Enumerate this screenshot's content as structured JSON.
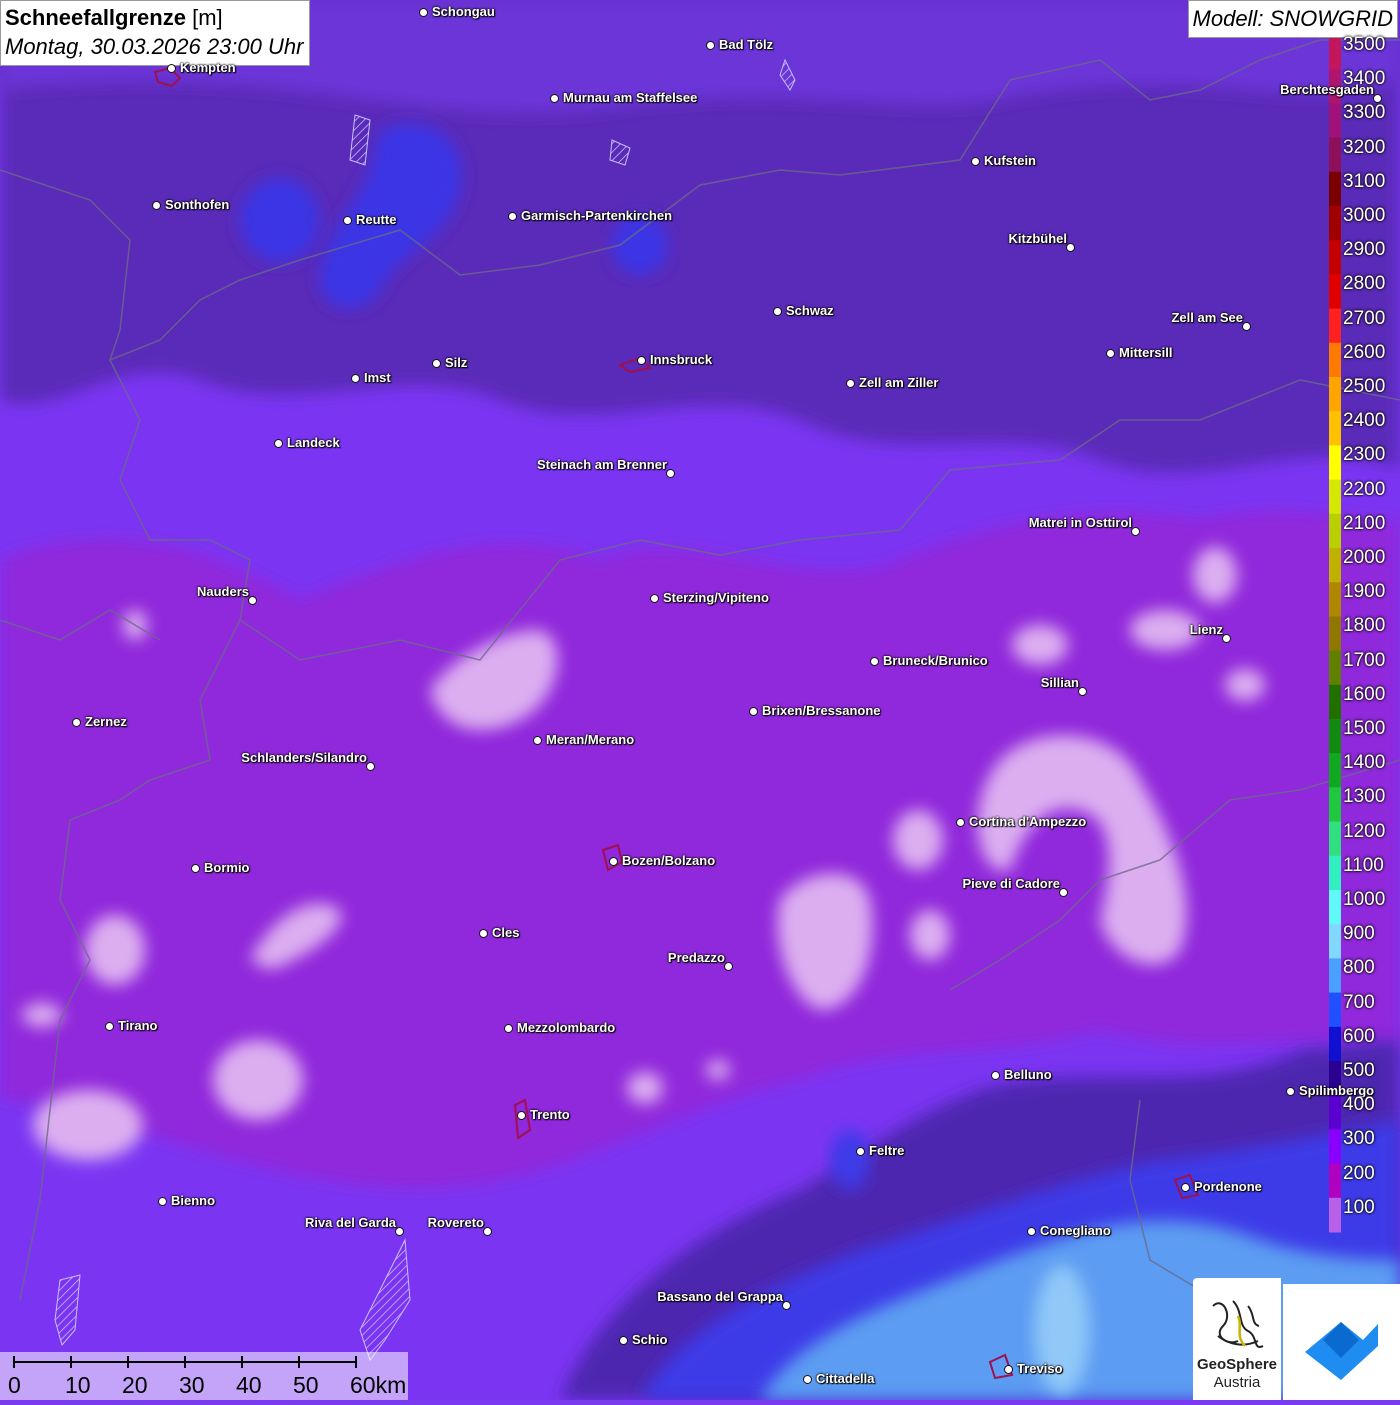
{
  "header": {
    "title_bold": "Schneefallgrenze",
    "title_unit": "[m]",
    "datetime": "Montag, 30.03.2026 23:00 Uhr",
    "model": "Modell: SNOWGRID"
  },
  "places": [
    {
      "name": "Schongau"
    },
    {
      "name": "Bad Tölz"
    },
    {
      "name": "Kempten"
    },
    {
      "name": "Murnau am Staffelsee"
    },
    {
      "name": "Berchtesgaden"
    },
    {
      "name": "Kufstein"
    },
    {
      "name": "Sonthofen"
    },
    {
      "name": "Reutte"
    },
    {
      "name": "Garmisch-Partenkirchen"
    },
    {
      "name": "Kitzbühel"
    },
    {
      "name": "Schwaz"
    },
    {
      "name": "Zell am See"
    },
    {
      "name": "Innsbruck"
    },
    {
      "name": "Mittersill"
    },
    {
      "name": "Imst"
    },
    {
      "name": "Silz"
    },
    {
      "name": "Zell am Ziller"
    },
    {
      "name": "Landeck"
    },
    {
      "name": "Steinach am Brenner"
    },
    {
      "name": "Matrei in Osttirol"
    },
    {
      "name": "Nauders"
    },
    {
      "name": "Sterzing/Vipiteno"
    },
    {
      "name": "Lienz"
    },
    {
      "name": "Bruneck/Brunico"
    },
    {
      "name": "Sillian"
    },
    {
      "name": "Zernez"
    },
    {
      "name": "Brixen/Bressanone"
    },
    {
      "name": "Meran/Merano"
    },
    {
      "name": "Schlanders/Silandro"
    },
    {
      "name": "Cortina d'Ampezzo"
    },
    {
      "name": "Bozen/Bolzano"
    },
    {
      "name": "Bormio"
    },
    {
      "name": "Pieve di Cadore"
    },
    {
      "name": "Cles"
    },
    {
      "name": "Predazzo"
    },
    {
      "name": "Tirano"
    },
    {
      "name": "Mezzolombardo"
    },
    {
      "name": "Belluno"
    },
    {
      "name": "Spilimbergo"
    },
    {
      "name": "Trento"
    },
    {
      "name": "Feltre"
    },
    {
      "name": "Pordenone"
    },
    {
      "name": "Bienno"
    },
    {
      "name": "Riva del Garda"
    },
    {
      "name": "Rovereto"
    },
    {
      "name": "Conegliano"
    },
    {
      "name": "Bassano del Grappa"
    },
    {
      "name": "Schio"
    },
    {
      "name": "Treviso"
    },
    {
      "name": "Cittadella"
    }
  ],
  "legend": {
    "labels": [
      "3500",
      "3400",
      "3300",
      "3200",
      "3100",
      "3000",
      "2900",
      "2800",
      "2700",
      "2600",
      "2500",
      "2400",
      "2300",
      "2200",
      "2100",
      "2000",
      "1900",
      "1800",
      "1700",
      "1600",
      "1500",
      "1400",
      "1300",
      "1200",
      "1100",
      "1000",
      "900",
      "800",
      "700",
      "600",
      "500",
      "400",
      "300",
      "200",
      "100"
    ],
    "colors": [
      "#c2185b",
      "#b0156e",
      "#a0127a",
      "#8e0f5a",
      "#7a0000",
      "#a00000",
      "#c40000",
      "#e00000",
      "#ff2020",
      "#ff7a00",
      "#ffa500",
      "#ffc000",
      "#ffff00",
      "#d4e800",
      "#b8d000",
      "#c0b000",
      "#b08800",
      "#907800",
      "#608000",
      "#207000",
      "#108a10",
      "#10a820",
      "#20c840",
      "#30e080",
      "#30f0c0",
      "#60f8f8",
      "#80d8ff",
      "#4aa0ff",
      "#2050ff",
      "#1010d0",
      "#2a0090",
      "#5a00d0",
      "#8a00ff",
      "#b000c0",
      "#b860e8"
    ]
  },
  "scale": {
    "labels": [
      "0",
      "10",
      "20",
      "30",
      "40",
      "50",
      "60km"
    ]
  },
  "logos": {
    "geosphere_line1": "GeoSphere",
    "geosphere_line2": "Austria"
  }
}
